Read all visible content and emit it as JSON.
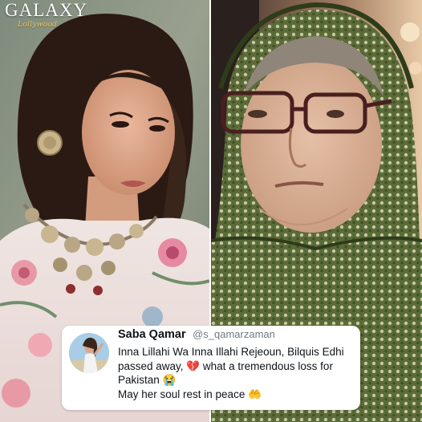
{
  "watermark": {
    "brand": "GALAXY",
    "subtitle": "Lollywood"
  },
  "images": {
    "left_icon": "portrait-photo-icon",
    "right_icon": "portrait-photo-icon"
  },
  "tweet": {
    "author_name": "Saba Qamar",
    "author_handle": "@s_qamarzaman",
    "line1": "Inna Lillahi Wa Inna Illahi Rejeoun, Bilquis Edhi passed away, 💔 what a tremendous loss for Pakistan 😭",
    "line2": "May her soul rest in peace 🤲",
    "avatar_icon": "avatar-icon"
  }
}
